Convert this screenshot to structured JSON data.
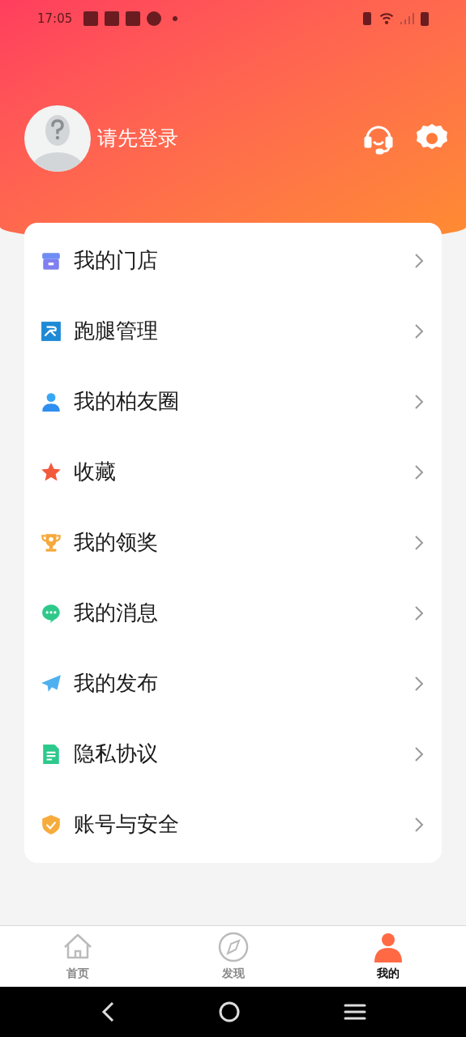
{
  "status_bar": {
    "time": "17:05"
  },
  "profile": {
    "login_prompt": "请先登录"
  },
  "menu": [
    {
      "kind": "store",
      "label": "我的门店"
    },
    {
      "kind": "errand",
      "label": "跑腿管理"
    },
    {
      "kind": "friends",
      "label": "我的柏友圈"
    },
    {
      "kind": "favorite",
      "label": "收藏"
    },
    {
      "kind": "prize",
      "label": "我的领奖"
    },
    {
      "kind": "message",
      "label": "我的消息"
    },
    {
      "kind": "publish",
      "label": "我的发布"
    },
    {
      "kind": "privacy",
      "label": "隐私协议"
    },
    {
      "kind": "security",
      "label": "账号与安全"
    }
  ],
  "tab_bar": [
    {
      "kind": "home",
      "label": "首页",
      "selected": false
    },
    {
      "kind": "discover",
      "label": "发现",
      "selected": false
    },
    {
      "kind": "profile",
      "label": "我的",
      "selected": true
    }
  ]
}
